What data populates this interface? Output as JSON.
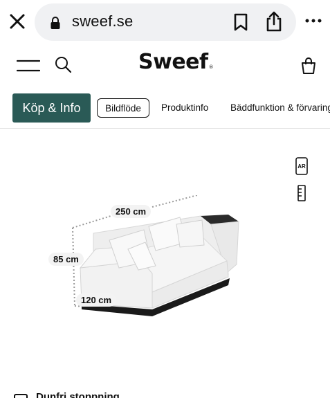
{
  "browser": {
    "url": "sweef.se",
    "icons": [
      "close-icon",
      "lock-icon",
      "bookmark-icon",
      "share-icon",
      "more-icon"
    ]
  },
  "header": {
    "logo_text": "Sweef",
    "logo_mark": "®",
    "icons": [
      "hamburger-icon",
      "search-icon",
      "bag-icon"
    ]
  },
  "tabs": [
    {
      "label": "Köp & Info",
      "style": "primary"
    },
    {
      "label": "Bildflöde",
      "style": "outlined"
    },
    {
      "label": "Produktinfo",
      "style": "plain"
    },
    {
      "label": "Bäddfunktion & förvaring",
      "style": "plain"
    }
  ],
  "viewer": {
    "ar_label": "AR",
    "dimensions": {
      "width": "250 cm",
      "height": "85 cm",
      "depth": "120 cm"
    }
  },
  "feature": {
    "label": "Dunfri stoppning"
  },
  "colors": {
    "accent": "#2a5a56",
    "url_bar": "#f0f1f3"
  }
}
